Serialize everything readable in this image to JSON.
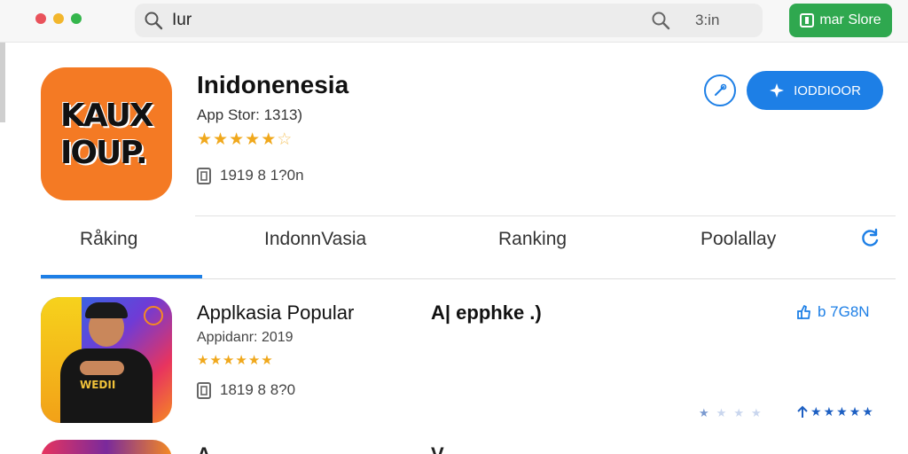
{
  "window": {
    "dots": [
      "#e9525b",
      "#f2b62c",
      "#35b64c"
    ]
  },
  "search": {
    "query": "Iur",
    "meta": "3:in"
  },
  "store_button": {
    "label": "mar Slore",
    "color": "#2fa84f"
  },
  "hero": {
    "icon_text_line1": "KAUX",
    "icon_text_line2": "IOUP.",
    "title": "Inidonenesia",
    "subtitle": "App Stor: 1313)",
    "rating_stars": 5,
    "count": "1919 8 1?0n",
    "get_label": "IODDIOOR",
    "accent": "#1d7fe6"
  },
  "tabs": [
    {
      "label": "Råking",
      "active": true
    },
    {
      "label": "IndonnVasia",
      "active": false
    },
    {
      "label": "Ranking",
      "active": false
    },
    {
      "label": "Poolallay",
      "active": false
    }
  ],
  "rows": [
    {
      "icon_shirt_text": "WEDII",
      "title": "Applkasia Popular",
      "tag": "A| epphke .)",
      "subtitle": "Appidanr: 2019",
      "rating_stars": 6,
      "count": "1819 8 8?0",
      "action_label": "b 7G8N",
      "mini_rating_stars": 5
    }
  ],
  "next_row": {
    "title_partial": "A",
    "tag_partial": "V"
  }
}
